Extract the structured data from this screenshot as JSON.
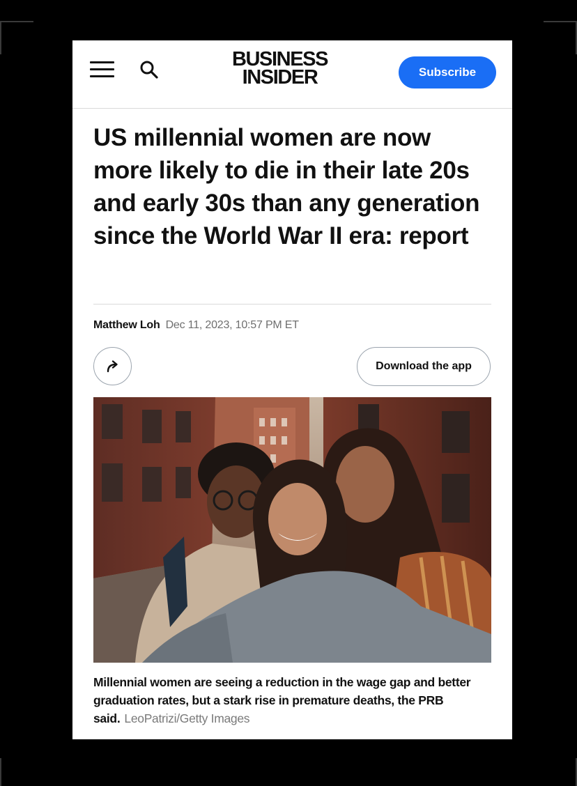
{
  "header": {
    "logo_line1": "BUSINESS",
    "logo_line2": "INSIDER",
    "subscribe_label": "Subscribe",
    "brand_color": "#1a6ef5"
  },
  "article": {
    "headline": "US millennial women are now more likely to die in their late 20s and early 30s than any generation since the World War II era: report",
    "author": "Matthew Loh",
    "date": "Dec 11, 2023, 10:57 PM ET",
    "download_label": "Download the app",
    "caption": "Millennial women are seeing a reduction in the wage gap and better graduation rates, but a stark rise in premature deaths, the PRB said.",
    "credit": "LeoPatrizi/Getty Images"
  },
  "icons": {
    "menu": "hamburger-menu-icon",
    "search": "search-icon",
    "share": "share-arrow-icon"
  }
}
